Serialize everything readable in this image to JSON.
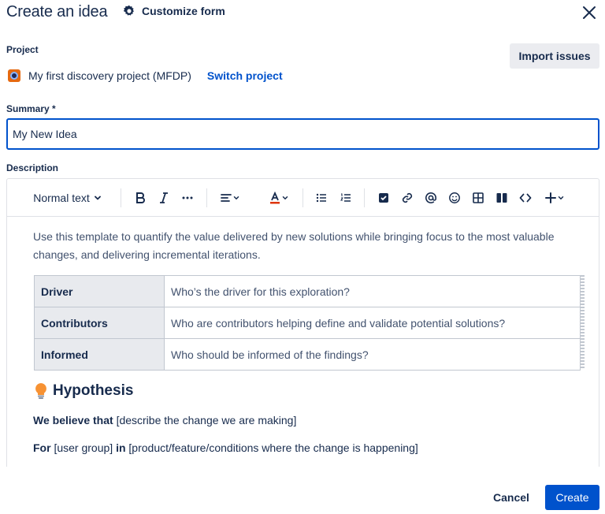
{
  "dialog": {
    "title": "Create an idea",
    "customize_label": "Customize form"
  },
  "project": {
    "label": "Project",
    "name": "My first discovery project (MFDP)",
    "switch_label": "Switch project",
    "import_label": "Import issues",
    "icon": "project-avatar-icon"
  },
  "summary": {
    "label": "Summary *",
    "value": "My New Idea"
  },
  "description": {
    "label": "Description",
    "toolbar": {
      "text_style": "Normal text",
      "icons": [
        "bold-icon",
        "italic-icon",
        "more-formatting-icon",
        "align-icon",
        "text-color-icon",
        "bullet-list-icon",
        "numbered-list-icon",
        "checkbox-icon",
        "link-icon",
        "mention-icon",
        "emoji-icon",
        "table-icon",
        "layout-icon",
        "code-icon",
        "insert-icon"
      ]
    },
    "intro": "Use this template to quantify the value delivered by new solutions while bringing focus to the most valuable changes, and delivering incremental iterations.",
    "table": [
      {
        "header": "Driver",
        "value": "Who’s the driver for this exploration?"
      },
      {
        "header": "Contributors",
        "value": "Who are contributors helping define and validate potential solutions?"
      },
      {
        "header": "Informed",
        "value": "Who should be informed of the findings?"
      }
    ],
    "hypothesis": {
      "title": "Hypothesis",
      "icon": "lightbulb-icon",
      "line1_bold": "We believe that",
      "line1_rest": "[describe the change we are making]",
      "line2_bold_a": "For",
      "line2_mid": "[user group]",
      "line2_bold_b": "in",
      "line2_rest": "[product/feature/conditions where the change is happening]"
    }
  },
  "footer": {
    "cancel_label": "Cancel",
    "create_label": "Create"
  },
  "colors": {
    "primary": "#0052cc",
    "text": "#172b4d",
    "subtle_text": "#42526e",
    "table_header_bg": "#e8eaee"
  }
}
